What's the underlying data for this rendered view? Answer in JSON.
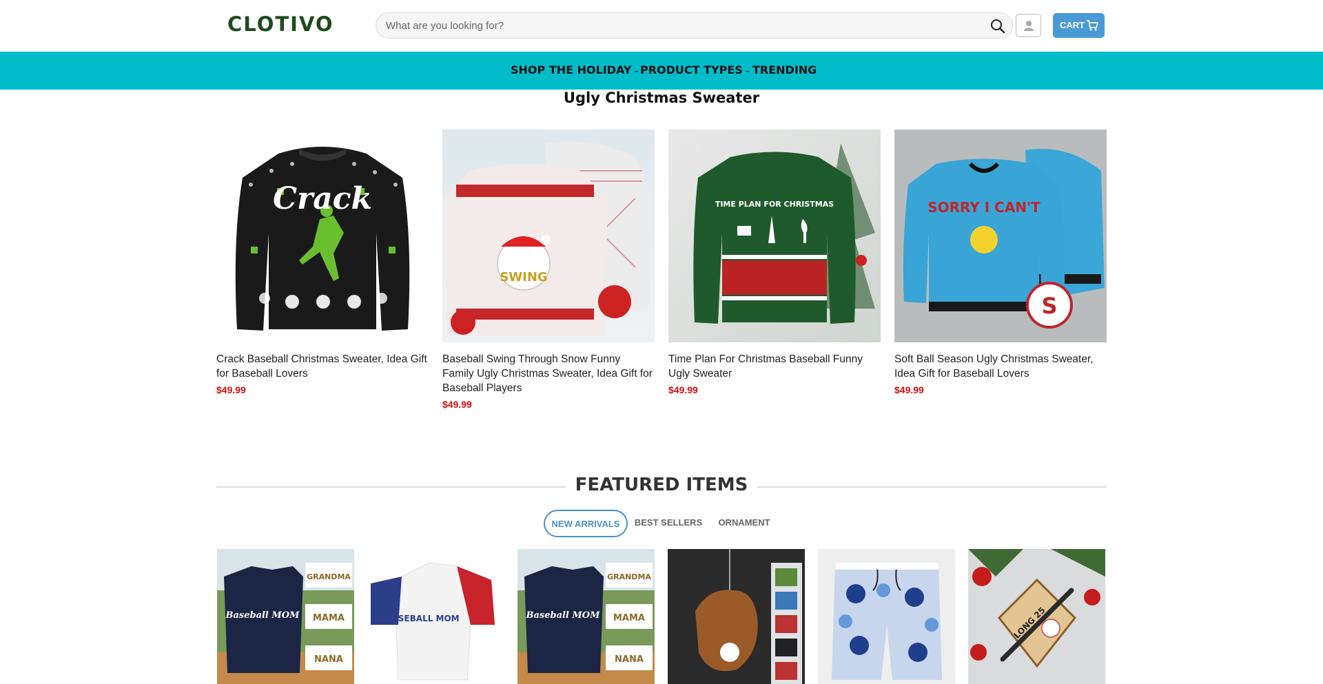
{
  "header": {
    "logo": "CLOTIVO",
    "search_placeholder": "What are you looking for?",
    "cart_label": "CART"
  },
  "nav": {
    "items": [
      {
        "label": "SHOP THE HOLIDAY",
        "has_dropdown": true
      },
      {
        "label": "PRODUCT TYPES",
        "has_dropdown": true
      },
      {
        "label": "TRENDING",
        "has_dropdown": false
      }
    ],
    "background": "#00bcc9"
  },
  "section": {
    "title": "Ugly Christmas Sweater",
    "products": [
      {
        "name": "Crack Baseball Christmas Sweater, Idea Gift for Baseball Lovers",
        "price": "$49.99",
        "image_text": "Crack"
      },
      {
        "name": "Baseball Swing Through Snow Funny Family Ugly Christmas Sweater, Idea Gift for Baseball Players",
        "price": "$49.99",
        "image_text": "SWING"
      },
      {
        "name": "Time Plan For Christmas Baseball Funny Ugly Sweater",
        "price": "$49.99",
        "image_text": "TIME PLAN FOR CHRISTMAS"
      },
      {
        "name": "Soft Ball Season Ugly Christmas Sweater, Idea Gift for Baseball Lovers",
        "price": "$49.99",
        "image_text": "SORRY I CAN'T"
      }
    ]
  },
  "featured": {
    "title": "FEATURED ITEMS",
    "tabs": [
      {
        "label": "NEW ARRIVALS",
        "active": true
      },
      {
        "label": "BEST SELLERS",
        "active": false
      },
      {
        "label": "ORNAMENT",
        "active": false
      }
    ],
    "items": [
      {
        "image_text": "Baseball MOM"
      },
      {
        "image_text": "BASEBALL MOM"
      },
      {
        "image_text": "Baseball MOM"
      },
      {
        "image_text": ""
      },
      {
        "image_text": ""
      },
      {
        "image_text": "LONG 25"
      }
    ]
  },
  "colors": {
    "accent": "#4a9ad6",
    "price": "#d31010",
    "logo": "#1c4a1c"
  }
}
